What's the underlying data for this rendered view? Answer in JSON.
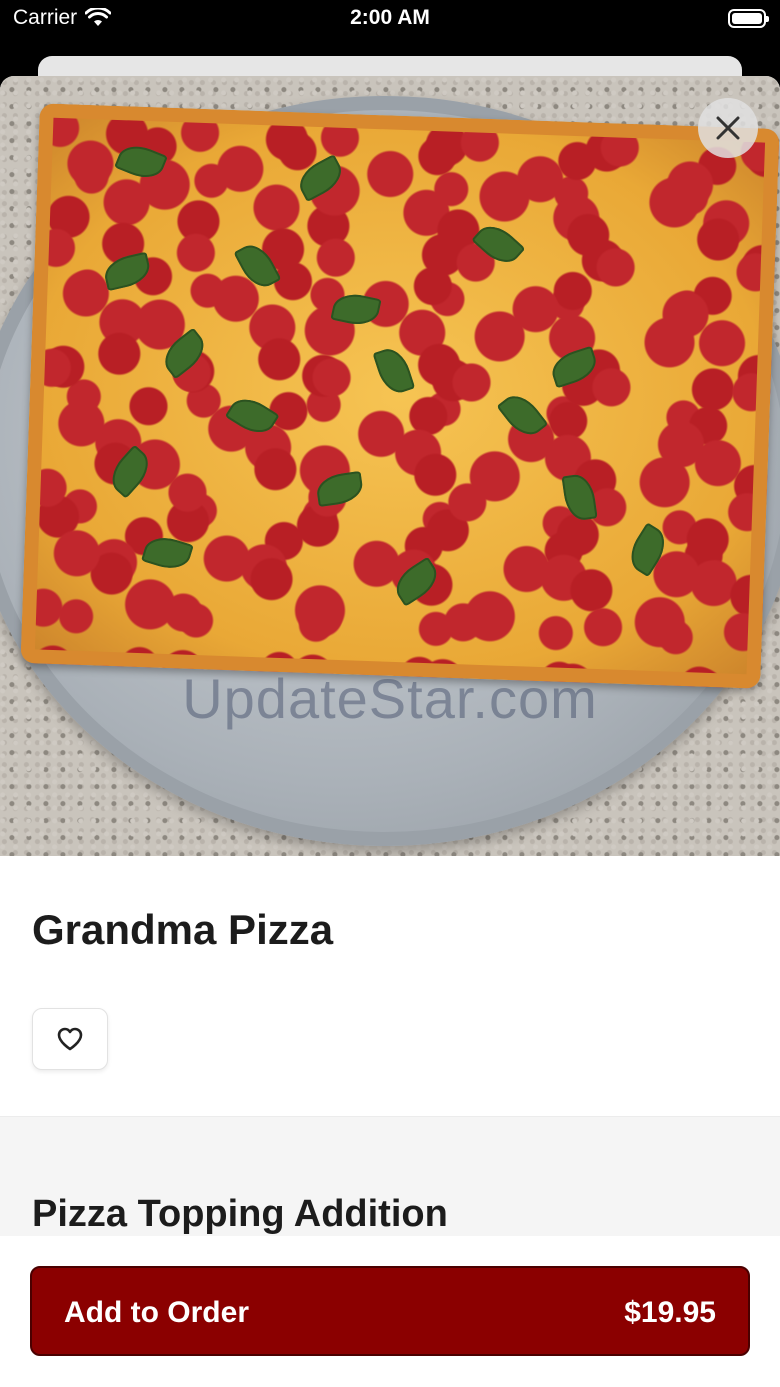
{
  "status_bar": {
    "carrier": "Carrier",
    "time": "2:00 AM"
  },
  "item": {
    "title": "Grandma Pizza",
    "image_watermark": "UpdateStar.com"
  },
  "section": {
    "title": "Pizza Topping Addition"
  },
  "order": {
    "label": "Add to Order",
    "price": "$19.95"
  },
  "colors": {
    "accent": "#8b0000"
  },
  "icons": {
    "close": "close-icon",
    "favorite": "heart-icon",
    "wifi": "wifi-icon",
    "battery": "battery-icon"
  }
}
